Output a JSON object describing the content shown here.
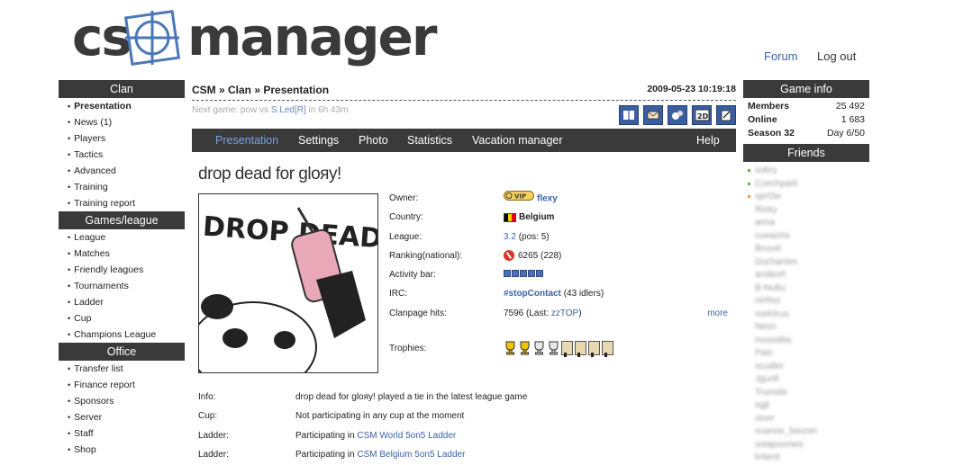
{
  "header": {
    "logo_left": "cs",
    "logo_right": "manager",
    "logo_icon": "crosshair-icon",
    "links": {
      "forum": "Forum",
      "logout": "Log out"
    }
  },
  "left": {
    "clan": {
      "title": "Clan",
      "items": [
        "Presentation",
        "News (1)",
        "Players",
        "Tactics",
        "Advanced",
        "Training",
        "Training report"
      ]
    },
    "games": {
      "title": "Games/league",
      "items": [
        "League",
        "Matches",
        "Friendly leagues",
        "Tournaments",
        "Ladder",
        "Cup",
        "Champions League"
      ]
    },
    "office": {
      "title": "Office",
      "items": [
        "Transfer list",
        "Finance report",
        "Sponsors",
        "Server",
        "Staff",
        "Shop"
      ]
    }
  },
  "main": {
    "breadcrumb": "CSM » Clan » Presentation",
    "datetime": "2009-05-23 10:19:18",
    "next_game": {
      "prefix": "Next game: pow vs ",
      "opponent": "S.Led[R]",
      "suffix": " in 6h 43m"
    },
    "toolbar_icons": [
      "book-icon",
      "mail-icon",
      "notes-icon",
      "2d-icon",
      "edit-icon"
    ],
    "toolbar_2d": "2D",
    "tabs": [
      "Presentation",
      "Settings",
      "Photo",
      "Statistics",
      "Vacation manager",
      "Help"
    ],
    "clan_title": "drop dead for gloяy!",
    "banner_text": "DROP DEAD",
    "details": {
      "owner_label": "Owner:",
      "owner_vip": "VIP",
      "owner_value": "flexy",
      "country_label": "Country:",
      "country_value": "Belgium",
      "league_label": "League:",
      "league_value": "3.2",
      "league_pos": "(pos: 5)",
      "ranking_label": "Ranking(national):",
      "ranking_value": "6265 (228)",
      "activity_label": "Activity bar:",
      "activity_level": 5,
      "irc_label": "IRC:",
      "irc_channel": "#stopContact",
      "irc_idlers": "(43 idlers)",
      "hits_label": "Clanpage hits:",
      "hits_value": "7596 (Last: ",
      "hits_last": "zzTOP",
      "hits_close": ")",
      "more": "more",
      "trophies_label": "Trophies:"
    },
    "info_rows": [
      {
        "label": "Info:",
        "text": "drop dead for gloяy! played a tie in the latest league game",
        "link": ""
      },
      {
        "label": "Cup:",
        "text": "Not participating in any cup at the moment",
        "link": ""
      },
      {
        "label": "Ladder:",
        "text": "Participating in ",
        "link": "CSM World 5on5 Ladder"
      },
      {
        "label": "Ladder:",
        "text": "Participating in ",
        "link": "CSM Belgium 5on5 Ladder"
      }
    ]
  },
  "right": {
    "game_info": {
      "title": "Game info",
      "rows": [
        {
          "key": "Members",
          "value": "25 492"
        },
        {
          "key": "Online",
          "value": "1 683"
        },
        {
          "key": "Season 32",
          "value": "Day 6/50"
        }
      ]
    },
    "friends": {
      "title": "Friends",
      "names": [
        "sobry",
        "Czechpark",
        "sprOw",
        "Ricky",
        "anna",
        "coewchs",
        "Bruuel",
        "Duchanies",
        "andaref",
        "B-Nuttu",
        "nirRez",
        "meKKus",
        "Nesri",
        "mossdita",
        "Paio",
        "scudler",
        "Jgunlt",
        "Trumide",
        "egjt",
        "viner",
        "suanne_bauner",
        "sotapoonies",
        "krlarot"
      ]
    }
  },
  "colors": {
    "dark_bar": "#3a3a3a",
    "link": "#3a63a8",
    "tab_selected": "#7aa3e0",
    "icon_blue": "#3b5ea0"
  }
}
